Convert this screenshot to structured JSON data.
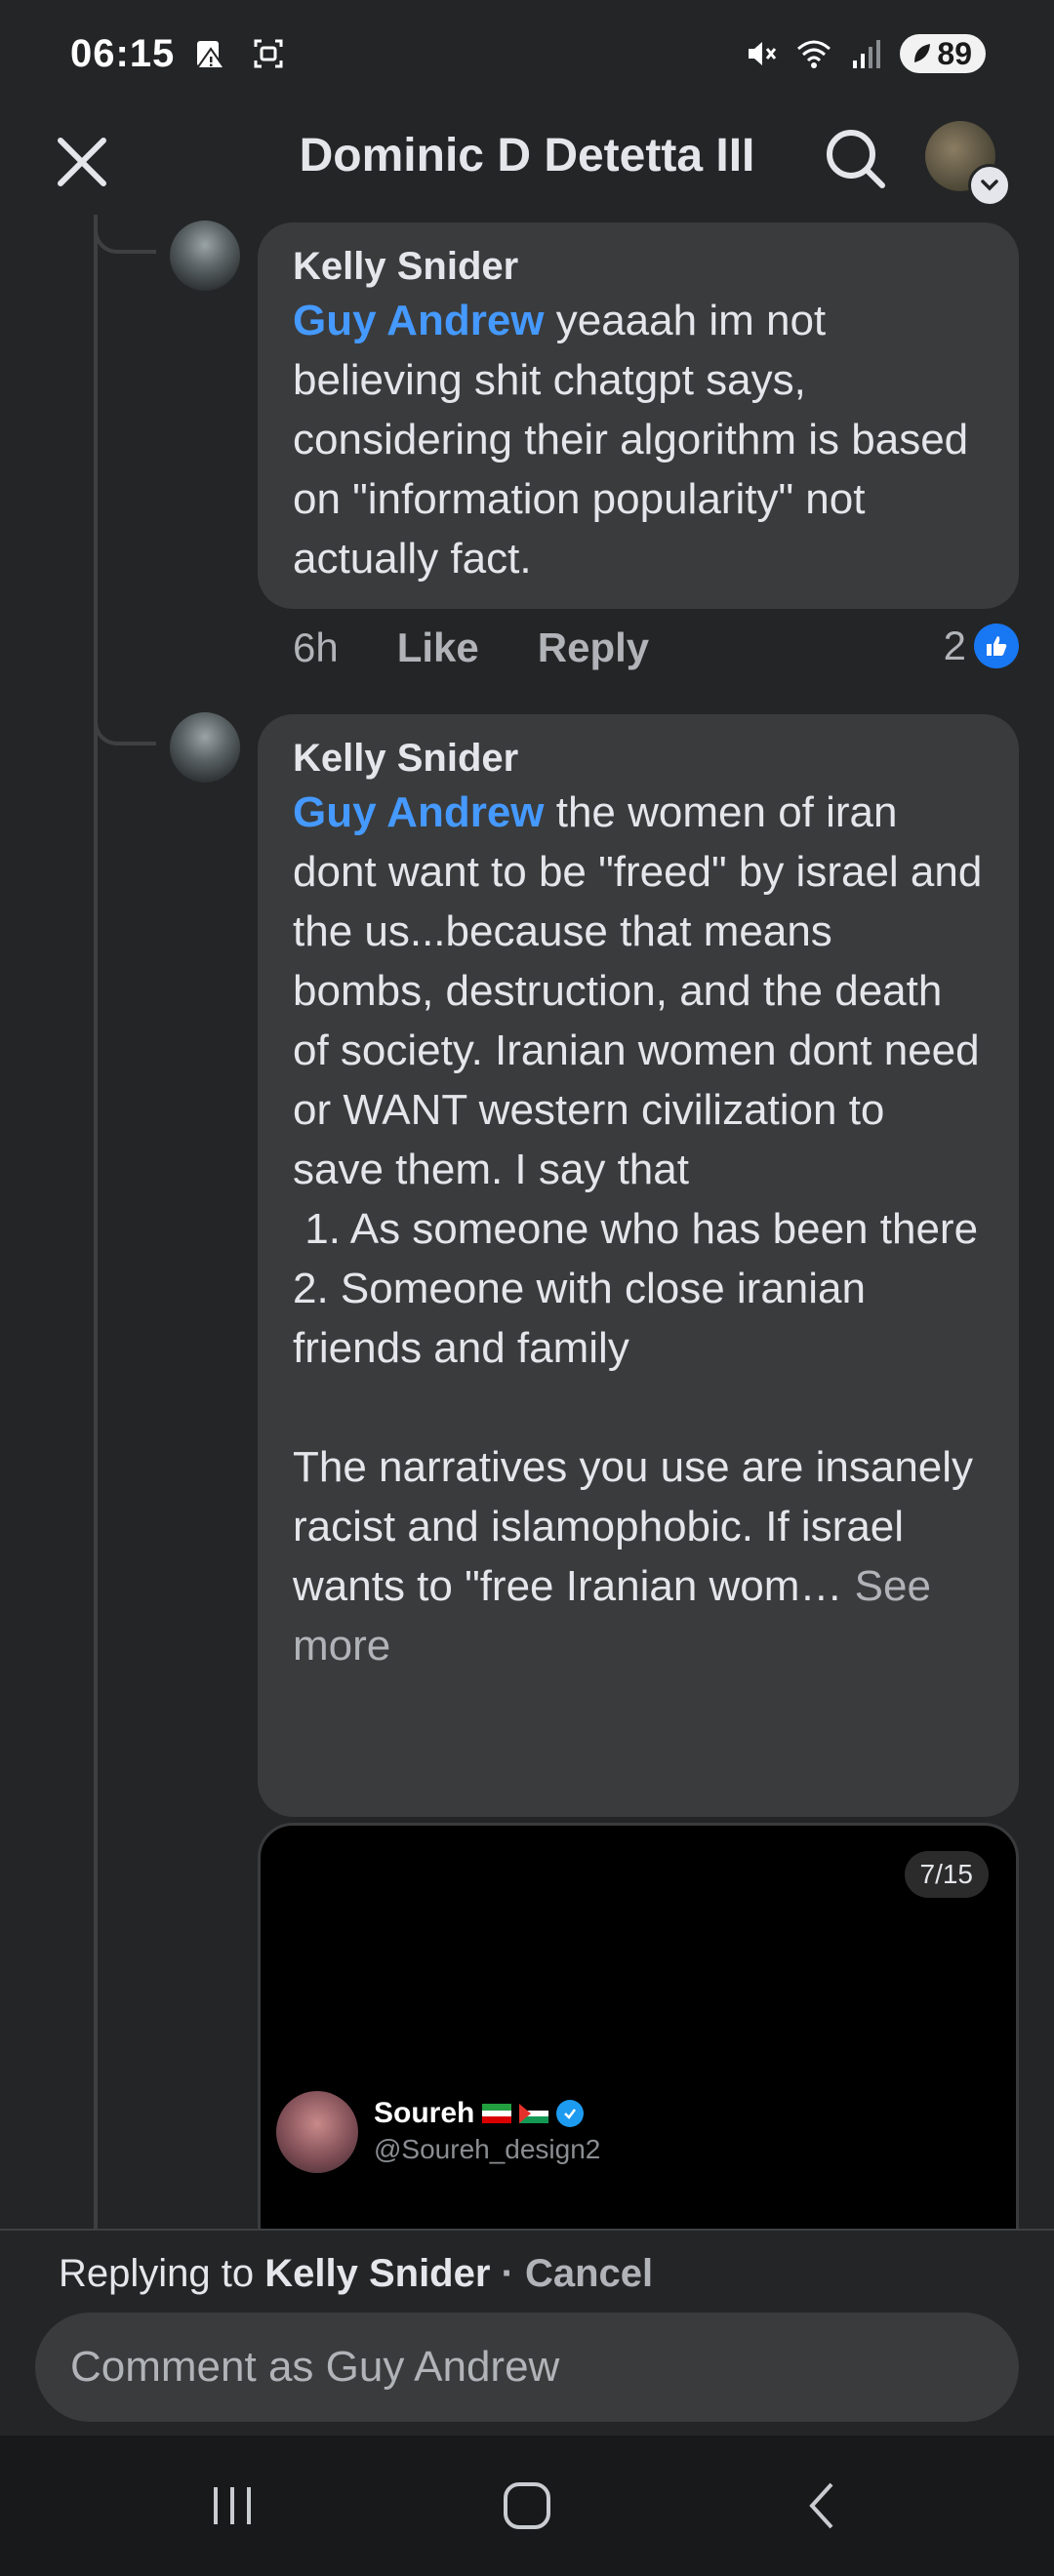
{
  "status_bar": {
    "time": "06:15",
    "battery": "89"
  },
  "header": {
    "title": "Dominic D Detetta III"
  },
  "comments": [
    {
      "author": "Kelly Snider",
      "mention": "Guy Andrew",
      "text": " yeaaah im not believing shit chatgpt says, considering their algorithm is based on \"information popularity\" not actually fact.",
      "time": "6h",
      "like_label": "Like",
      "reply_label": "Reply",
      "reaction_count": "2"
    },
    {
      "author": "Kelly Snider",
      "mention": "Guy Andrew",
      "text": " the women of iran dont want to be \"freed\" by israel and the us...because that means bombs, destruction, and the death of society. Iranian women dont need or WANT western civilization to save them. I say that\n 1. As someone who has been there\n2. Someone with close iranian friends and family\n\nThe narratives you use are insanely racist and islamophobic. If israel wants to \"free Iranian wom… ",
      "see_more": "See more"
    }
  ],
  "media": {
    "counter": "7/15",
    "name": "Soureh",
    "handle": "@Soureh_design2"
  },
  "reply_bar": {
    "replying_prefix": "Replying to ",
    "replying_name": "Kelly Snider",
    "separator": " · ",
    "cancel": "Cancel",
    "placeholder": "Comment as Guy Andrew"
  },
  "colors": {
    "background": "#242526",
    "bubble": "#3a3b3c",
    "mention": "#4599ff",
    "like": "#1877f2"
  }
}
